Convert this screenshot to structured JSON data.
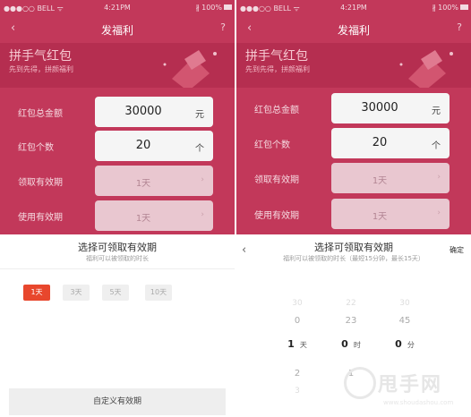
{
  "colors": {
    "brand_red": "#c2385a",
    "selected_chip": "#e8472d"
  },
  "status_bar": {
    "carrier": "●●●○○ BELL ᯤ",
    "time": "4:21PM",
    "battery": "∦ 100%"
  },
  "nav": {
    "title": "发福利",
    "back_icon": "chevron-left-icon",
    "help_icon": "question-icon"
  },
  "banner": {
    "title": "拼手气红包",
    "subtitle": "先到先得，拼颜福利"
  },
  "form": {
    "total_label": "红包总金额",
    "total_value": "30000",
    "total_unit": "元",
    "count_label": "红包个数",
    "count_value": "20",
    "count_unit": "个",
    "claim_label": "领取有效期",
    "claim_value": "1天",
    "use_label": "使用有效期",
    "use_value": "1天"
  },
  "left_sheet": {
    "title": "选择可领取有效期",
    "subtitle": "福利可以被领取的时长",
    "options": [
      "1天",
      "3天",
      "5天",
      "10天"
    ],
    "selected": "1天",
    "custom_button": "自定义有效期"
  },
  "right_sheet": {
    "title": "选择可领取有效期",
    "subtitle": "福利可以被领取的时长（最短15分钟，最长15天）",
    "confirm": "确定",
    "days": {
      "faint_above": "30",
      "above": "0",
      "selected": "1",
      "unit": "天",
      "below": "2",
      "faint_below": "3"
    },
    "hours": {
      "faint_above": "22",
      "above": "23",
      "selected": "0",
      "unit": "时",
      "below": "1"
    },
    "minutes": {
      "faint_above": "30",
      "above": "45",
      "selected": "0",
      "unit": "分"
    }
  },
  "watermark": {
    "text": "甩手网",
    "url": "www.shoudashou.com"
  }
}
